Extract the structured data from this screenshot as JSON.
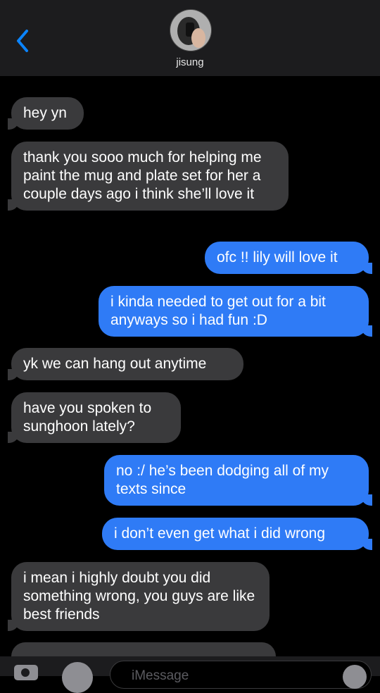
{
  "header": {
    "contact_name": "jisung"
  },
  "messages": [
    {
      "side": "in",
      "text": "hey yn"
    },
    {
      "side": "in",
      "text": "thank you sooo much for helping me paint the mug and plate set for her a couple days ago i think she’ll love it"
    },
    {
      "side": "out",
      "text": "ofc !! lily will love it"
    },
    {
      "side": "out",
      "text": "i kinda needed to get out for a bit anyways so i had fun :D"
    },
    {
      "side": "in",
      "text": "yk we can hang out anytime"
    },
    {
      "side": "in",
      "text": "have you spoken to sunghoon lately?"
    },
    {
      "side": "out",
      "text": "no :/ he’s been dodging all of my texts since"
    },
    {
      "side": "out",
      "text": "i don’t even get what i did wrong"
    },
    {
      "side": "in",
      "text": "i mean i highly doubt you did something wrong, you guys are like best friends"
    }
  ],
  "composer": {
    "placeholder": "iMessage"
  },
  "colors": {
    "incoming": "#3a3a3c",
    "outgoing": "#2f7bf6",
    "accent": "#0a84ff"
  }
}
